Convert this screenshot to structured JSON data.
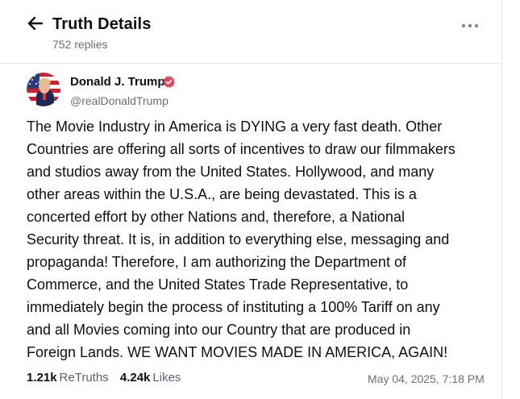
{
  "header": {
    "title": "Truth Details",
    "replies": "752 replies"
  },
  "icons": {
    "back": "arrow-left-icon",
    "more": "ellipsis-icon",
    "verified": "verified-badge-icon"
  },
  "author": {
    "name": "Donald J. Trump",
    "handle": "@realDonaldTrump",
    "verified": true
  },
  "post": {
    "text": "The Movie Industry in America is DYING a very fast death. Other\nCountries are offering all sorts of incentives to draw our filmmakers\nand studios away from the United States. Hollywood, and many\nother areas within the U.S.A., are being devastated. This is a\nconcerted effort by other Nations and, therefore, a National\nSecurity threat. It is, in addition to everything else, messaging and\npropaganda! Therefore, I am authorizing the Department of\nCommerce, and the United States Trade Representative, to\nimmediately begin the process of instituting a 100% Tariff on any\nand all Movies coming into our Country that are produced in\nForeign Lands. WE WANT MOVIES MADE IN AMERICA, AGAIN!",
    "timestamp": "May 04, 2025, 7:18 PM"
  },
  "stats": {
    "retruths_count": "1.21k",
    "retruths_label": "ReTruths",
    "likes_count": "4.24k",
    "likes_label": "Likes"
  },
  "colors": {
    "verified_badge": "#e8445a",
    "primary_text": "#0f0f14",
    "secondary_text": "#6b6f7a",
    "divider": "#e6e6ea"
  }
}
